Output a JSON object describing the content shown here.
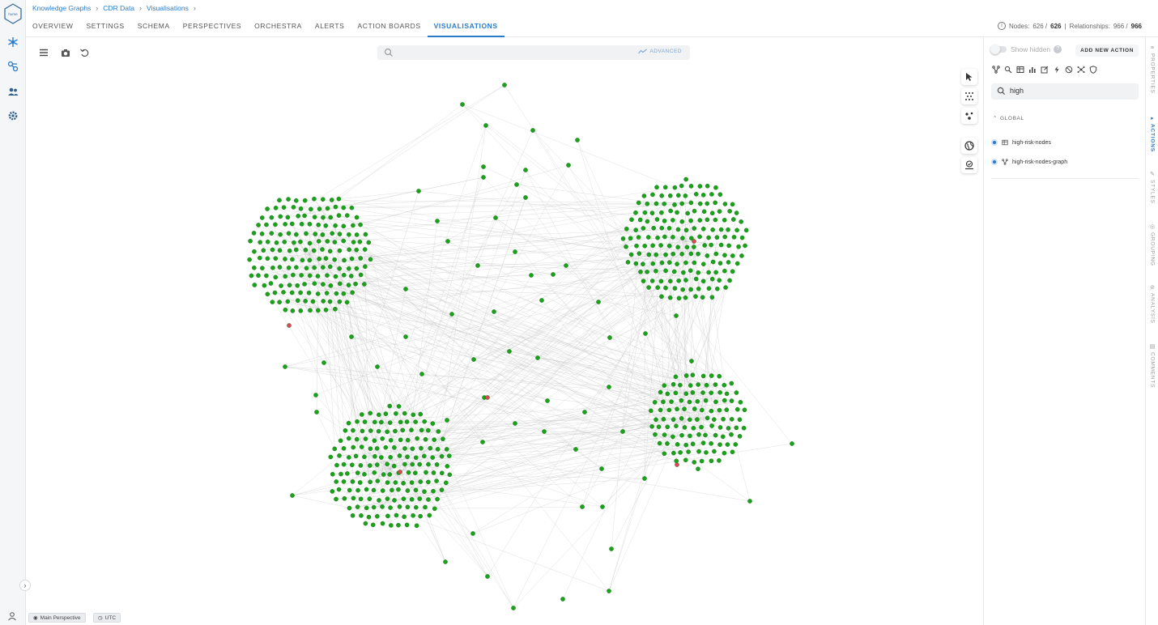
{
  "breadcrumb": [
    "Knowledge Graphs",
    "CDR Data",
    "Visualisations"
  ],
  "tabs": [
    "OVERVIEW",
    "SETTINGS",
    "SCHEMA",
    "PERSPECTIVES",
    "ORCHESTRA",
    "ALERTS",
    "ACTION BOARDS",
    "VISUALISATIONS"
  ],
  "active_tab": "VISUALISATIONS",
  "counts": {
    "nodes_label": "Nodes:",
    "nodes_value": "626 /",
    "nodes_total": "626",
    "sep": "|",
    "rels_label": "Relationships:",
    "rels_value": "966 /",
    "rels_total": "966"
  },
  "logo_text": "hume",
  "search": {
    "placeholder": "",
    "advanced_label": "ADVANCED"
  },
  "bottom": {
    "perspective": "Main Perspective",
    "timezone": "UTC"
  },
  "panel": {
    "show_hidden": "Show hidden",
    "add_action": "ADD NEW ACTION",
    "filter_value": "high",
    "group": "GLOBAL",
    "actions": [
      {
        "label": "high-risk-nodes",
        "icon": "table-icon"
      },
      {
        "label": "high-risk-nodes-graph",
        "icon": "graph-icon"
      }
    ]
  },
  "vertical_tabs": [
    "PROPERTIES",
    "ACTIONS",
    "STYLES",
    "GROUPING",
    "ANALYSIS",
    "COMMENTS"
  ],
  "active_vertical_tab": "ACTIONS",
  "colors": {
    "accent": "#2a7bc9",
    "node": "#1aa31a",
    "alert_node": "#e0455a",
    "edge": "#c9c9c9"
  }
}
